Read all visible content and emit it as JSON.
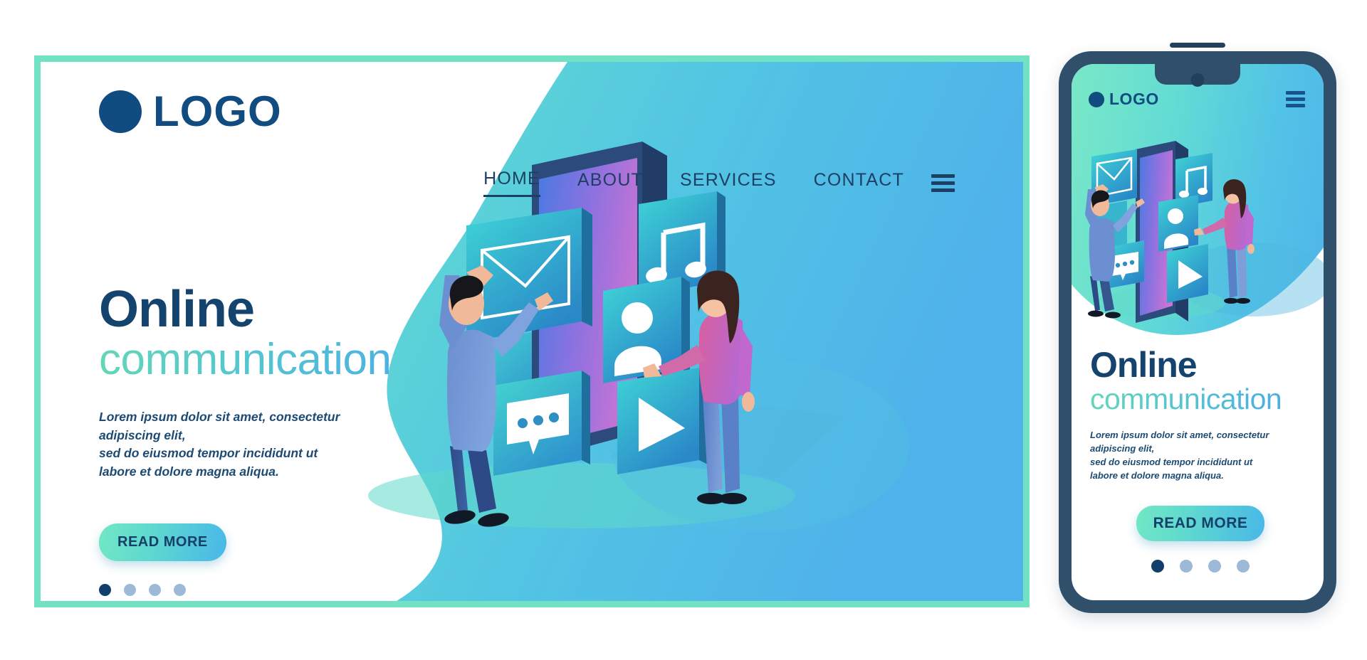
{
  "brand": {
    "logo_text": "LOGO",
    "logo_icon": "circle-dot-icon",
    "navy": "#14436e",
    "mint": "#72e2c4",
    "accent_blue": "#4aa9e8"
  },
  "desktop": {
    "nav": {
      "items": [
        {
          "label": "HOME",
          "active": true
        },
        {
          "label": "ABOUT",
          "active": false
        },
        {
          "label": "SERVICES",
          "active": false
        },
        {
          "label": "CONTACT",
          "active": false
        }
      ],
      "menu_icon": "hamburger-menu-icon"
    },
    "hero": {
      "title_line1": "Online",
      "title_line2": "communication",
      "body": "Lorem ipsum dolor sit amet, consectetur adipiscing elit, sed do eiusmod tempor incididunt ut labore et dolore magna aliqua.",
      "body_lines": [
        "Lorem ipsum dolor sit amet, consectetur adipiscing elit,",
        "sed do eiusmod tempor incididunt ut",
        "labore et dolore magna aliqua."
      ],
      "cta_label": "READ MORE",
      "carousel_dots": 4,
      "carousel_active_index": 0
    },
    "illustration": {
      "name": "isometric-online-communication-illustration",
      "elements": [
        "smartphone-device",
        "envelope-card",
        "music-note-card",
        "user-profile-card",
        "chat-bubble-card",
        "play-button-card",
        "man-character",
        "woman-character"
      ]
    }
  },
  "mobile": {
    "logo_text": "LOGO",
    "menu_icon": "hamburger-menu-icon",
    "hero": {
      "title_line1": "Online",
      "title_line2": "communication",
      "body_lines": [
        "Lorem ipsum dolor sit amet, consectetur adipiscing elit,",
        "sed do eiusmod tempor incididunt ut",
        "labore et dolore magna aliqua."
      ],
      "cta_label": "READ MORE",
      "carousel_dots": 4,
      "carousel_active_index": 0
    }
  }
}
